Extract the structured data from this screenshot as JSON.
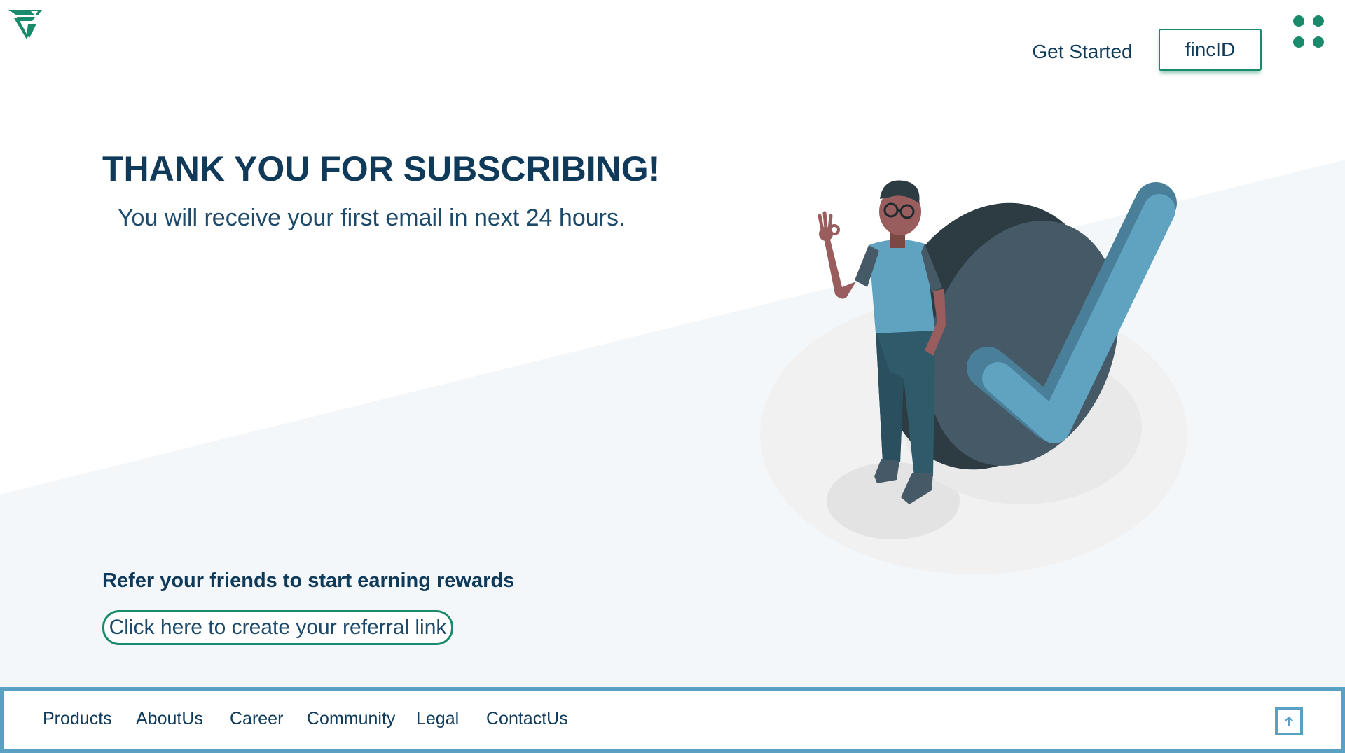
{
  "header": {
    "logo_icon": "fincstack-logo-icon",
    "get_started_label": "Get Started",
    "fincid_label": "fincID",
    "apps_icon": "app-grid-icon"
  },
  "hero": {
    "title": "THANK YOU FOR SUBSCRIBING!",
    "subtitle": "You will receive your first email in next 24 hours."
  },
  "referral": {
    "heading": "Refer your friends to start earning rewards",
    "button_label": "Click here to create your referral link"
  },
  "illustration": {
    "icon": "person-with-checkmark-illustration"
  },
  "footer": {
    "links": [
      {
        "label": "Products"
      },
      {
        "label": "AboutUs"
      },
      {
        "label": "Career"
      },
      {
        "label": "Community"
      },
      {
        "label": "Legal"
      },
      {
        "label": "ContactUs"
      }
    ],
    "scroll_top_icon": "arrow-up-icon"
  },
  "colors": {
    "accent": "#1a8a6c",
    "navy": "#0f3a5a",
    "band": "#f4f7fa",
    "footer_border": "#5aa0c2"
  }
}
